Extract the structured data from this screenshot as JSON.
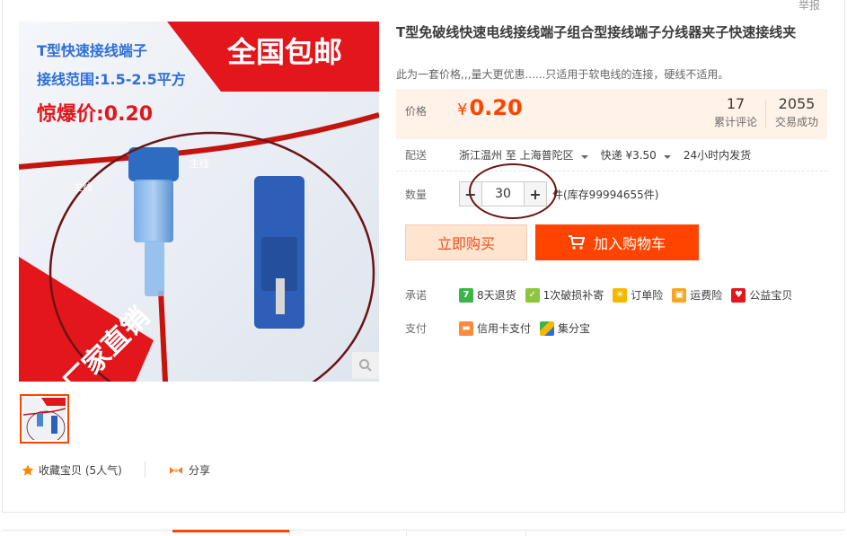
{
  "report_link": "举报",
  "image": {
    "banner_left_line1": "T型快速接线端子",
    "banner_left_line2": "接线范围:1.5-2.5平方",
    "banner_left_line3": "惊爆价:0.20",
    "banner_right": "全国包邮",
    "banner_bottom": "厂家直销",
    "wire_label": "主线",
    "thumbnail_alt": "product thumbnail"
  },
  "favorite": {
    "label": "收藏宝贝 (5人气)",
    "icon": "star-icon"
  },
  "share": {
    "label": "分享",
    "icon": "share-icon"
  },
  "product": {
    "title": "T型免破线快速电线接线端子组合型接线端子分线器夹子快速接线夹",
    "subtitle": "此为一套价格,,,量大更优惠......只适用于软电线的连接，硬线不适用。"
  },
  "price": {
    "label": "价格",
    "currency": "¥",
    "value": "0.20",
    "reviews_count": "17",
    "reviews_label": "累计评论",
    "sold_count": "2055",
    "sold_label": "交易成功"
  },
  "delivery": {
    "label": "配送",
    "route": "浙江温州 至  上海普陀区",
    "shipping": "快递 ¥3.50",
    "dispatch": "24小时内发货"
  },
  "quantity": {
    "label": "数量",
    "minus": "−",
    "plus": "+",
    "value": "30",
    "stock": "件(库存99994655件)"
  },
  "buttons": {
    "buy_now": "立即购买",
    "add_to_cart": "加入购物车"
  },
  "promises": {
    "label": "承诺",
    "items": [
      "8天退货",
      "1次破损补寄",
      "订单险",
      "运费险",
      "公益宝贝"
    ]
  },
  "payment": {
    "label": "支付",
    "items": [
      "信用卡支付",
      "集分宝"
    ]
  },
  "colors": {
    "accent": "#ff4400",
    "price_bg": "#fff2e8",
    "annotation": "#6b1414"
  }
}
